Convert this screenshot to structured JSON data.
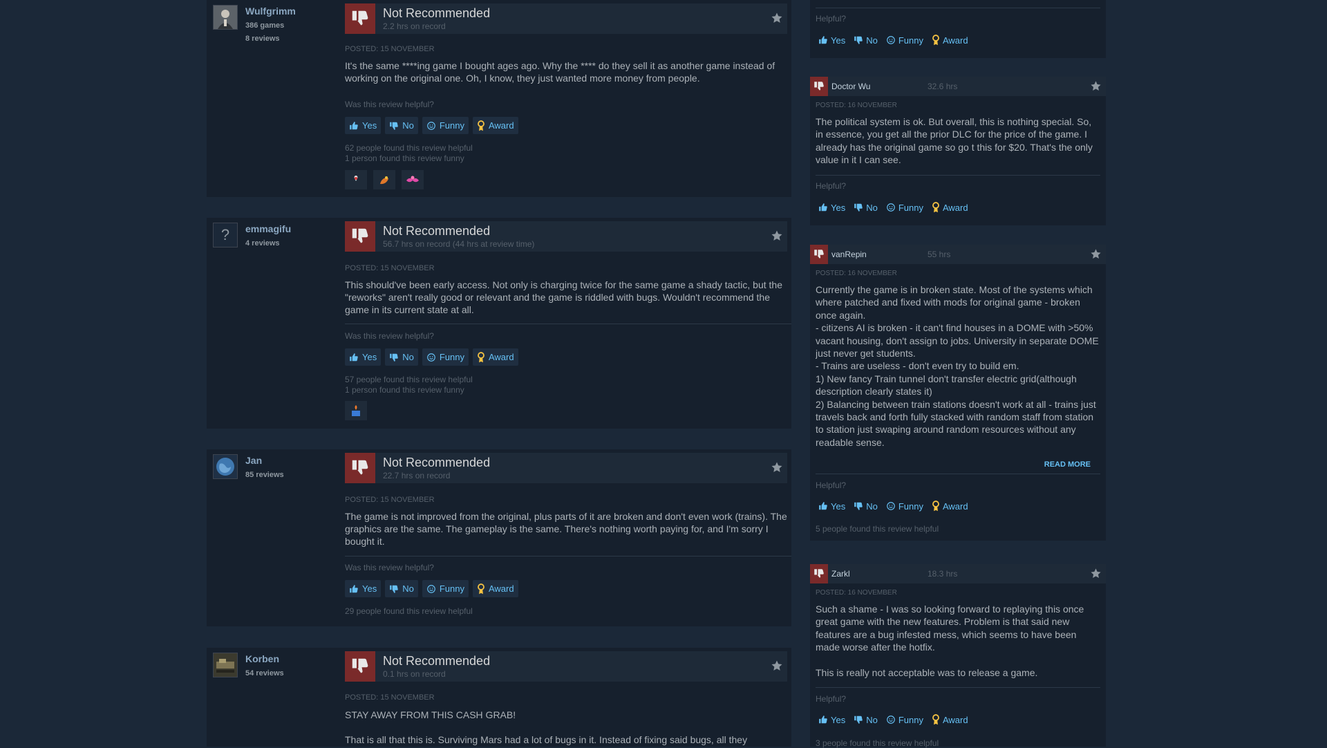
{
  "colors": {
    "background": "#1b2838",
    "card": "#16202d",
    "accent_link": "#66c0f4",
    "thumb_down": "#c83c3c"
  },
  "buttons": {
    "yes": "Yes",
    "no": "No",
    "funny": "Funny",
    "award": "Award"
  },
  "left_reviews": [
    {
      "author": "Wulfgrimm",
      "games": "386 games",
      "reviews": "8 reviews",
      "verdict": "Not Recommended",
      "hours": "2.2 hrs on record",
      "posted": "Posted: 15 November",
      "text": "It's the same ****ing game I bought ages ago. Why the **** do they sell it as another game instead of working on the original one. Oh, I know, they just wanted more money from people.",
      "helpful_question": "Was this review helpful?",
      "found_helpful": "62 people found this review helpful",
      "found_funny": "1 person found this review funny"
    },
    {
      "author": "emmagifu",
      "reviews": "4 reviews",
      "verdict": "Not Recommended",
      "hours": "56.7 hrs on record (44 hrs at review time)",
      "posted": "Posted: 15 November",
      "text": "This should've been early access. Not only is charging twice for the same game a shady tactic, but the \"reworks\" aren't really good or relevant and the game is riddled with bugs. Wouldn't recommend the game in its current state at all.",
      "helpful_question": "Was this review helpful?",
      "found_helpful": "57 people found this review helpful",
      "found_funny": "1 person found this review funny"
    },
    {
      "author": "Jan",
      "reviews": "85 reviews",
      "verdict": "Not Recommended",
      "hours": "22.7 hrs on record",
      "posted": "Posted: 15 November",
      "text": "The game is not improved from the original, plus parts of it are broken and don't even work (trains). The graphics are the same. The gameplay is the same. There's nothing worth paying for, and I'm sorry I bought it.",
      "helpful_question": "Was this review helpful?",
      "found_helpful": "29 people found this review helpful"
    },
    {
      "author": "Korben",
      "reviews": "54 reviews",
      "verdict": "Not Recommended",
      "hours": "0.1 hrs on record",
      "posted": "Posted: 15 November",
      "text": "STAY AWAY FROM THIS CASH GRAB!",
      "text2": "That is all that this is. Surviving Mars had a lot of bugs in it. Instead of fixing said bugs, all they"
    }
  ],
  "right_reviews": [
    {
      "helpful_question": "Helpful?"
    },
    {
      "author": "Doctor Wu",
      "hours": "32.6 hrs",
      "posted": "Posted: 16 November",
      "text": "The political system is ok. But overall, this is nothing special. So, in essence, you get all the prior DLC for the price of the game. I already has the original game so go t this for $20. That's the only value in it I can see.",
      "helpful_question": "Helpful?"
    },
    {
      "author": "vanRepin",
      "hours": "55 hrs",
      "posted": "Posted: 16 November",
      "lines": [
        "Currently the game is in broken state. Most of the systems which where patched and fixed with mods for original game - broken once again.",
        "- citizens AI is broken - it can't find houses in a DOME with >50% vacant housing, don't assign to jobs. University in separate DOME just never get students.",
        "- Trains are useless - don't even try to build em.",
        "1) New fancy Train tunnel don't transfer electric grid(although description clearly states it)",
        "2) Balancing between train stations doesn't work at all - trains just travels back and forth fully stacked with random staff from station to station just swaping around random resources without any readable sense."
      ],
      "read_more": "Read More",
      "helpful_question": "Helpful?",
      "found_helpful": "5 people found this review helpful"
    },
    {
      "author": "Zarkl",
      "hours": "18.3 hrs",
      "posted": "Posted: 16 November",
      "text": "Such a shame - I was so looking forward to replaying this once great game with the new features. Problem is that said new features are a bug infested mess, which seems to have been made worse after the hotfix.",
      "text2": "This is really not acceptable was to release a game.",
      "helpful_question": "Helpful?",
      "found_helpful": "3 people found this review helpful"
    }
  ]
}
